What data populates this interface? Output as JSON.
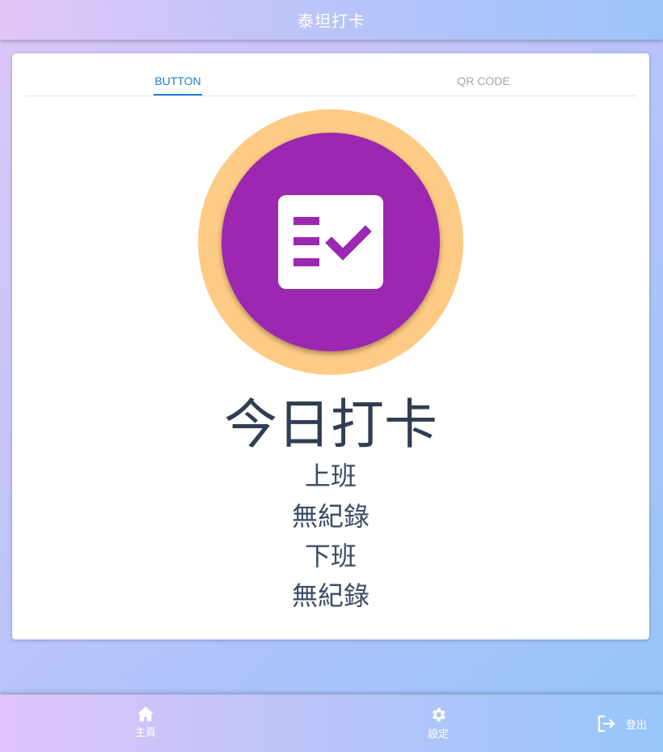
{
  "app_bar": {
    "title": "泰坦打卡"
  },
  "tabs": [
    {
      "label": "BUTTON",
      "active": true
    },
    {
      "label": "QR CODE",
      "active": false
    }
  ],
  "punch": {
    "icon": "checklist-icon",
    "title": "今日打卡",
    "clock_in_label": "上班",
    "clock_in_status": "無紀錄",
    "clock_out_label": "下班",
    "clock_out_status": "無紀錄"
  },
  "bottom_nav": {
    "home": {
      "label": "主頁",
      "icon": "home-icon"
    },
    "settings": {
      "label": "設定",
      "icon": "gear-icon"
    },
    "logout": {
      "label": "登出",
      "icon": "logout-icon"
    }
  },
  "colors": {
    "accent_tab": "#1f7fd1",
    "punch_ring": "#fdcb85",
    "punch_circle": "#9c27b0",
    "text_dark": "#2f3e50"
  }
}
